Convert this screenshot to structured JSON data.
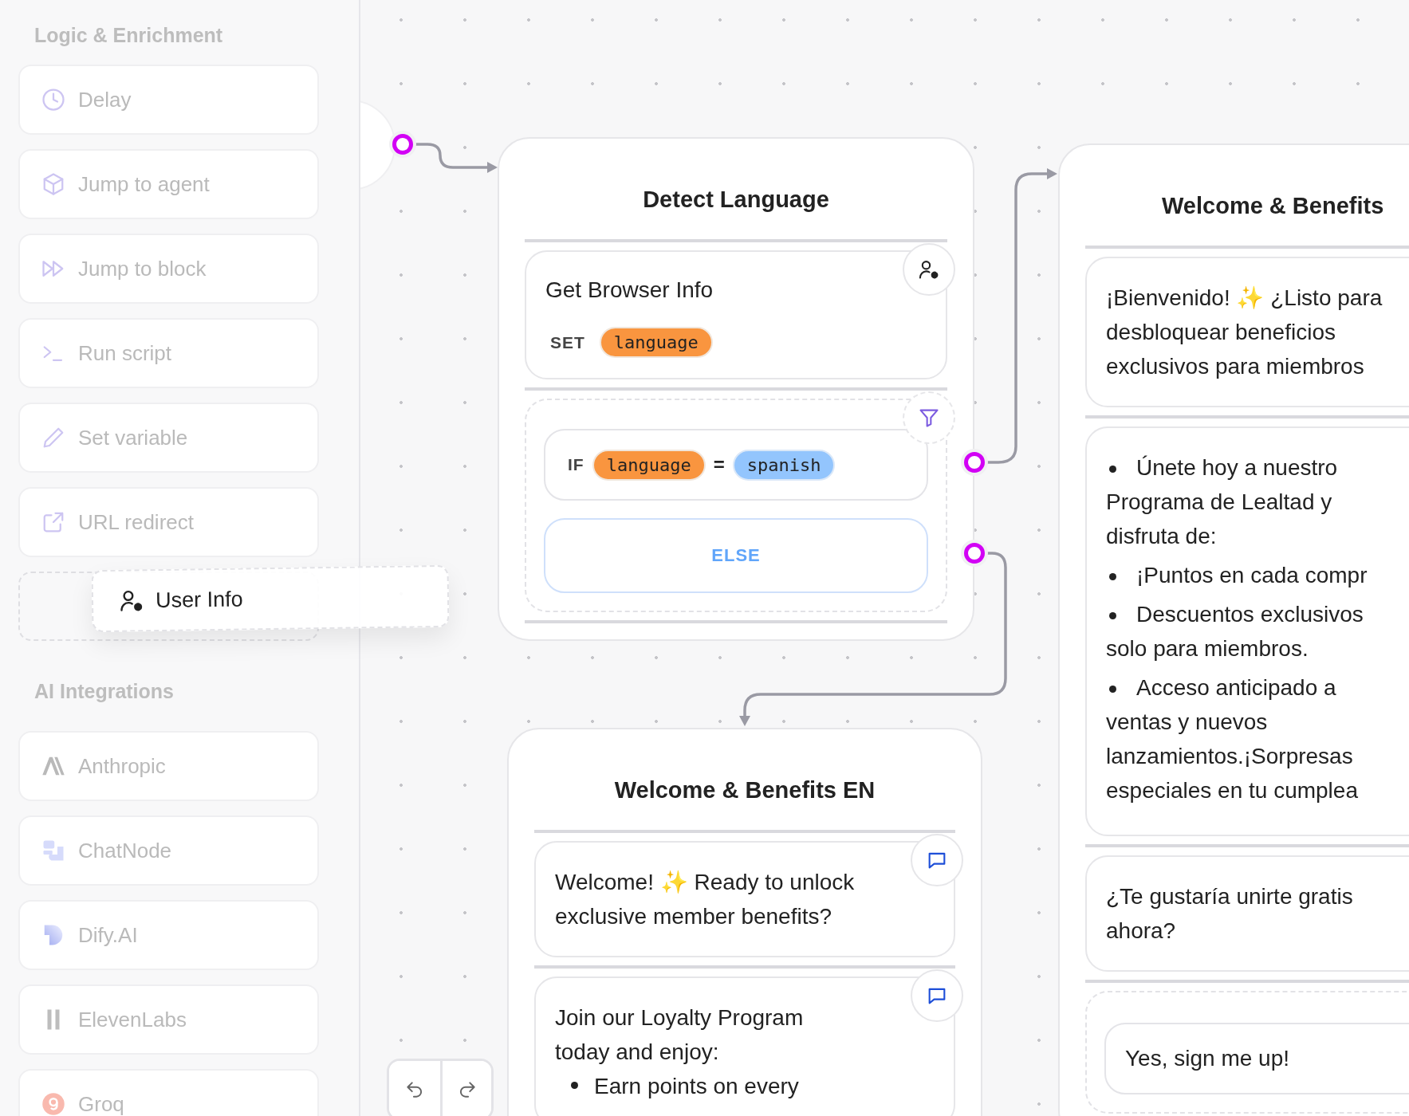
{
  "sidebar": {
    "sections": [
      {
        "title": "Logic & Enrichment",
        "items": [
          {
            "label": "Delay"
          },
          {
            "label": "Jump to agent"
          },
          {
            "label": "Jump to block"
          },
          {
            "label": "Run script"
          },
          {
            "label": "Set variable"
          },
          {
            "label": "URL redirect"
          }
        ]
      },
      {
        "title": "AI Integrations",
        "items": [
          {
            "label": "Anthropic"
          },
          {
            "label": "ChatNode"
          },
          {
            "label": "Dify.AI"
          },
          {
            "label": "ElevenLabs"
          },
          {
            "label": "Groq"
          }
        ]
      }
    ],
    "dragging": {
      "label": "User Info"
    }
  },
  "canvas": {
    "nodes": [
      {
        "title": "Detect Language",
        "blocks": [
          {
            "kind": "set",
            "badge": true,
            "title": "Get Browser Info",
            "keyword": "SET",
            "variable": "language"
          },
          {
            "kind": "condition",
            "badge": true,
            "keyword": "IF",
            "variable": "language",
            "operator": "=",
            "value": "spanish",
            "else_label": "ELSE"
          }
        ]
      },
      {
        "title": "Welcome & Benefits EN",
        "blocks": [
          {
            "kind": "message",
            "badge": true,
            "items": [
              {
                "kind": "text",
                "lines": [
                  "Welcome! ✨ Ready to unlock",
                  "exclusive member benefits?"
                ]
              }
            ]
          },
          {
            "kind": "message",
            "badge": true,
            "items": [
              {
                "kind": "text",
                "lines": [
                  "Join our Loyalty Program",
                  "today and enjoy:"
                ]
              },
              {
                "kind": "list_item",
                "lines": [
                  "Earn points on every"
                ]
              }
            ]
          }
        ]
      },
      {
        "title": "Welcome & Benefits",
        "blocks": [
          {
            "kind": "message",
            "badge": false,
            "items": [
              {
                "kind": "text",
                "lines": [
                  "¡Bienvenido! ✨ ¿Listo para",
                  "desbloquear beneficios",
                  "exclusivos para miembros"
                ]
              }
            ]
          },
          {
            "kind": "message",
            "badge": false,
            "items": [
              {
                "kind": "bullet",
                "lines": [
                  "Únete hoy a nuestro",
                  "Programa de Lealtad y",
                  "disfruta de:"
                ]
              },
              {
                "kind": "bullet",
                "lines": [
                  "¡Puntos en cada compr"
                ]
              },
              {
                "kind": "bullet",
                "lines": [
                  "Descuentos exclusivos",
                  "solo para miembros."
                ]
              },
              {
                "kind": "bullet",
                "lines": [
                  "Acceso anticipado a",
                  "ventas y nuevos",
                  "lanzamientos.¡Sorpresas",
                  "especiales en tu cumplea"
                ]
              }
            ]
          },
          {
            "kind": "message",
            "badge": false,
            "items": [
              {
                "kind": "text",
                "lines": [
                  "¿Te gustaría unirte gratis",
                  "ahora?"
                ]
              }
            ]
          },
          {
            "kind": "choices",
            "badge": false,
            "choices": [
              {
                "label": "Yes, sign me up!"
              }
            ]
          }
        ]
      }
    ]
  }
}
